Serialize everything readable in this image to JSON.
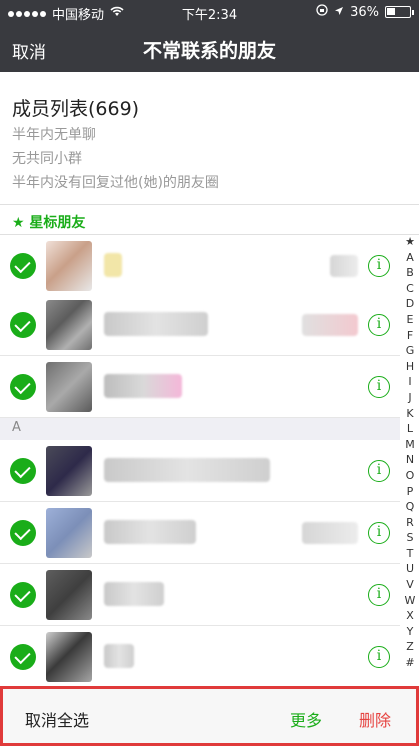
{
  "status_bar": {
    "carrier": "中国移动",
    "time": "下午2:34",
    "battery": "36%",
    "battery_level": 0.36
  },
  "nav": {
    "cancel_label": "取消",
    "title": "不常联系的朋友"
  },
  "summary": {
    "title": "成员列表(669)",
    "criteria": [
      "半年内无单聊",
      "无共同小群",
      "半年内没有回复过他(她)的朋友圈"
    ]
  },
  "star_section": {
    "label": "★ 星标朋友"
  },
  "section_a": {
    "label": "A"
  },
  "info_glyph": "i",
  "index_letters": [
    "★",
    "A",
    "B",
    "C",
    "D",
    "E",
    "F",
    "G",
    "H",
    "I",
    "J",
    "K",
    "L",
    "M",
    "N",
    "O",
    "P",
    "Q",
    "R",
    "S",
    "T",
    "U",
    "V",
    "W",
    "X",
    "Y",
    "Z",
    "#"
  ],
  "toolbar": {
    "deselect_label": "取消全选",
    "more_label": "更多",
    "delete_label": "删除"
  },
  "colors": {
    "accent": "#1aad19",
    "delete": "#e64340",
    "nav_bg": "#393a3f"
  }
}
